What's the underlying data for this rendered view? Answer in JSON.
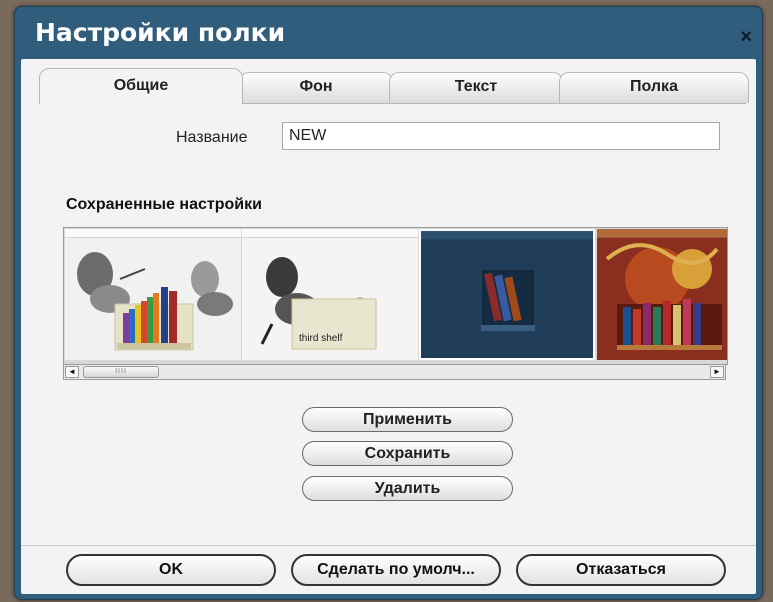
{
  "dialog": {
    "title": "Настройки полки",
    "close_glyph": "×"
  },
  "tabs": [
    {
      "label": "Общие",
      "active": true
    },
    {
      "label": "Фон",
      "active": false
    },
    {
      "label": "Текст",
      "active": false
    },
    {
      "label": "Полка",
      "active": false
    }
  ],
  "name_field": {
    "label": "Название",
    "value": "NEW"
  },
  "saved_settings": {
    "heading": "Сохраненные настройки",
    "thumbnails": [
      {
        "theme": "light",
        "background": "#f1f1ef"
      },
      {
        "theme": "light",
        "background": "#f4f4f2",
        "shelf_label": "third shelf"
      },
      {
        "theme": "dark-blue",
        "background": "#1f3d59"
      },
      {
        "theme": "red-orange",
        "background": "#8a2f1f"
      }
    ]
  },
  "scrollbar": {
    "left_arrow": "◄",
    "right_arrow": "►",
    "thumb_grip": "IIII"
  },
  "actions": {
    "apply": "Применить",
    "save": "Сохранить",
    "delete": "Удалить"
  },
  "footer": {
    "ok": "OK",
    "make_default": "Сделать по умолч...",
    "cancel": "Отказаться"
  },
  "colors": {
    "title_bar": "#2f5d7b",
    "panel": "#f3f3f3"
  }
}
